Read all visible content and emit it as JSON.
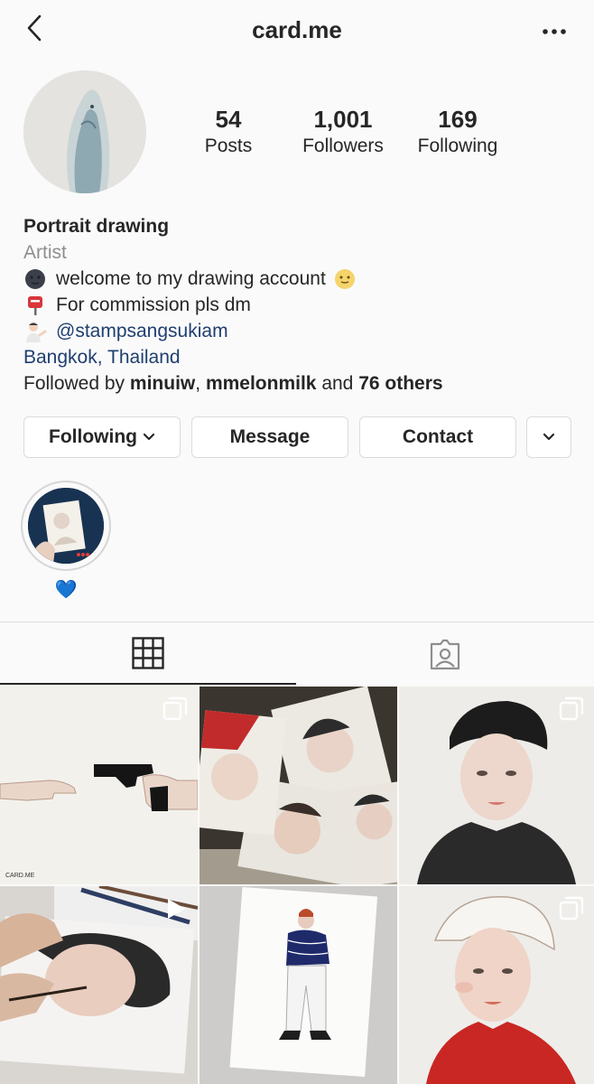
{
  "header": {
    "username": "card.me"
  },
  "stats": [
    {
      "value": "54",
      "label": "Posts"
    },
    {
      "value": "1,001",
      "label": "Followers"
    },
    {
      "value": "169",
      "label": "Following"
    }
  ],
  "bio": {
    "name": "Portrait drawing",
    "category": "Artist",
    "lines": [
      {
        "icon": "new-moon-face-emoji",
        "text": "welcome to my drawing account",
        "trailing_icon": "slightly-smiling-emoji"
      },
      {
        "icon": "postbox-emoji",
        "text": "For commission pls dm"
      },
      {
        "icon": "person-tipping-hand-emoji",
        "text": "@stampsangsukiam"
      }
    ],
    "location": "Bangkok, Thailand",
    "followed_by": {
      "prefix": "Followed by",
      "user1": "minuiw",
      "sep": ",",
      "user2": "mmelonmilk",
      "and": "and",
      "others": "76 others"
    }
  },
  "actions": {
    "following": "Following",
    "message": "Message",
    "contact": "Contact"
  },
  "highlight": {
    "label": "💙"
  },
  "tabs": [
    {
      "icon": "grid-icon",
      "active": true
    },
    {
      "icon": "tagged-person-icon",
      "active": false
    }
  ],
  "posts": [
    {
      "type": "carousel",
      "subject": "hands with gun drawing",
      "signature": "CARD.ME"
    },
    {
      "type": "single",
      "subject": "stack of portrait drawings"
    },
    {
      "type": "carousel",
      "subject": "portrait with beret"
    },
    {
      "type": "video",
      "subject": "painting a portrait"
    },
    {
      "type": "single",
      "subject": "full body figure drawing"
    },
    {
      "type": "carousel",
      "subject": "portrait with red sweater"
    }
  ],
  "colors": {
    "link": "#1f3f70",
    "text": "#262626",
    "muted": "#8e8e8e",
    "border": "#dbdbdb",
    "background": "#fafafa"
  }
}
